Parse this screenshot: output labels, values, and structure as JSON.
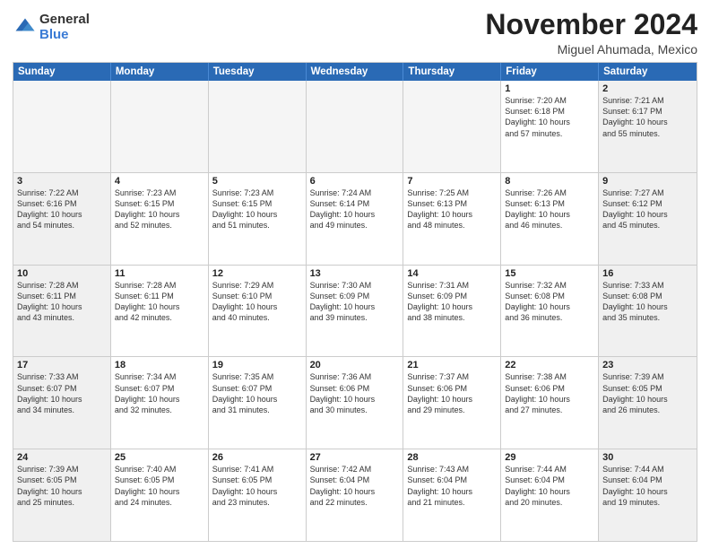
{
  "header": {
    "logo_general": "General",
    "logo_blue": "Blue",
    "month_title": "November 2024",
    "location": "Miguel Ahumada, Mexico"
  },
  "days_of_week": [
    "Sunday",
    "Monday",
    "Tuesday",
    "Wednesday",
    "Thursday",
    "Friday",
    "Saturday"
  ],
  "weeks": [
    [
      {
        "day": "",
        "info": "",
        "empty": true
      },
      {
        "day": "",
        "info": "",
        "empty": true
      },
      {
        "day": "",
        "info": "",
        "empty": true
      },
      {
        "day": "",
        "info": "",
        "empty": true
      },
      {
        "day": "",
        "info": "",
        "empty": true
      },
      {
        "day": "1",
        "info": "Sunrise: 7:20 AM\nSunset: 6:18 PM\nDaylight: 10 hours\nand 57 minutes.",
        "empty": false
      },
      {
        "day": "2",
        "info": "Sunrise: 7:21 AM\nSunset: 6:17 PM\nDaylight: 10 hours\nand 55 minutes.",
        "empty": false
      }
    ],
    [
      {
        "day": "3",
        "info": "Sunrise: 7:22 AM\nSunset: 6:16 PM\nDaylight: 10 hours\nand 54 minutes.",
        "empty": false
      },
      {
        "day": "4",
        "info": "Sunrise: 7:23 AM\nSunset: 6:15 PM\nDaylight: 10 hours\nand 52 minutes.",
        "empty": false
      },
      {
        "day": "5",
        "info": "Sunrise: 7:23 AM\nSunset: 6:15 PM\nDaylight: 10 hours\nand 51 minutes.",
        "empty": false
      },
      {
        "day": "6",
        "info": "Sunrise: 7:24 AM\nSunset: 6:14 PM\nDaylight: 10 hours\nand 49 minutes.",
        "empty": false
      },
      {
        "day": "7",
        "info": "Sunrise: 7:25 AM\nSunset: 6:13 PM\nDaylight: 10 hours\nand 48 minutes.",
        "empty": false
      },
      {
        "day": "8",
        "info": "Sunrise: 7:26 AM\nSunset: 6:13 PM\nDaylight: 10 hours\nand 46 minutes.",
        "empty": false
      },
      {
        "day": "9",
        "info": "Sunrise: 7:27 AM\nSunset: 6:12 PM\nDaylight: 10 hours\nand 45 minutes.",
        "empty": false
      }
    ],
    [
      {
        "day": "10",
        "info": "Sunrise: 7:28 AM\nSunset: 6:11 PM\nDaylight: 10 hours\nand 43 minutes.",
        "empty": false
      },
      {
        "day": "11",
        "info": "Sunrise: 7:28 AM\nSunset: 6:11 PM\nDaylight: 10 hours\nand 42 minutes.",
        "empty": false
      },
      {
        "day": "12",
        "info": "Sunrise: 7:29 AM\nSunset: 6:10 PM\nDaylight: 10 hours\nand 40 minutes.",
        "empty": false
      },
      {
        "day": "13",
        "info": "Sunrise: 7:30 AM\nSunset: 6:09 PM\nDaylight: 10 hours\nand 39 minutes.",
        "empty": false
      },
      {
        "day": "14",
        "info": "Sunrise: 7:31 AM\nSunset: 6:09 PM\nDaylight: 10 hours\nand 38 minutes.",
        "empty": false
      },
      {
        "day": "15",
        "info": "Sunrise: 7:32 AM\nSunset: 6:08 PM\nDaylight: 10 hours\nand 36 minutes.",
        "empty": false
      },
      {
        "day": "16",
        "info": "Sunrise: 7:33 AM\nSunset: 6:08 PM\nDaylight: 10 hours\nand 35 minutes.",
        "empty": false
      }
    ],
    [
      {
        "day": "17",
        "info": "Sunrise: 7:33 AM\nSunset: 6:07 PM\nDaylight: 10 hours\nand 34 minutes.",
        "empty": false
      },
      {
        "day": "18",
        "info": "Sunrise: 7:34 AM\nSunset: 6:07 PM\nDaylight: 10 hours\nand 32 minutes.",
        "empty": false
      },
      {
        "day": "19",
        "info": "Sunrise: 7:35 AM\nSunset: 6:07 PM\nDaylight: 10 hours\nand 31 minutes.",
        "empty": false
      },
      {
        "day": "20",
        "info": "Sunrise: 7:36 AM\nSunset: 6:06 PM\nDaylight: 10 hours\nand 30 minutes.",
        "empty": false
      },
      {
        "day": "21",
        "info": "Sunrise: 7:37 AM\nSunset: 6:06 PM\nDaylight: 10 hours\nand 29 minutes.",
        "empty": false
      },
      {
        "day": "22",
        "info": "Sunrise: 7:38 AM\nSunset: 6:06 PM\nDaylight: 10 hours\nand 27 minutes.",
        "empty": false
      },
      {
        "day": "23",
        "info": "Sunrise: 7:39 AM\nSunset: 6:05 PM\nDaylight: 10 hours\nand 26 minutes.",
        "empty": false
      }
    ],
    [
      {
        "day": "24",
        "info": "Sunrise: 7:39 AM\nSunset: 6:05 PM\nDaylight: 10 hours\nand 25 minutes.",
        "empty": false
      },
      {
        "day": "25",
        "info": "Sunrise: 7:40 AM\nSunset: 6:05 PM\nDaylight: 10 hours\nand 24 minutes.",
        "empty": false
      },
      {
        "day": "26",
        "info": "Sunrise: 7:41 AM\nSunset: 6:05 PM\nDaylight: 10 hours\nand 23 minutes.",
        "empty": false
      },
      {
        "day": "27",
        "info": "Sunrise: 7:42 AM\nSunset: 6:04 PM\nDaylight: 10 hours\nand 22 minutes.",
        "empty": false
      },
      {
        "day": "28",
        "info": "Sunrise: 7:43 AM\nSunset: 6:04 PM\nDaylight: 10 hours\nand 21 minutes.",
        "empty": false
      },
      {
        "day": "29",
        "info": "Sunrise: 7:44 AM\nSunset: 6:04 PM\nDaylight: 10 hours\nand 20 minutes.",
        "empty": false
      },
      {
        "day": "30",
        "info": "Sunrise: 7:44 AM\nSunset: 6:04 PM\nDaylight: 10 hours\nand 19 minutes.",
        "empty": false
      }
    ]
  ]
}
